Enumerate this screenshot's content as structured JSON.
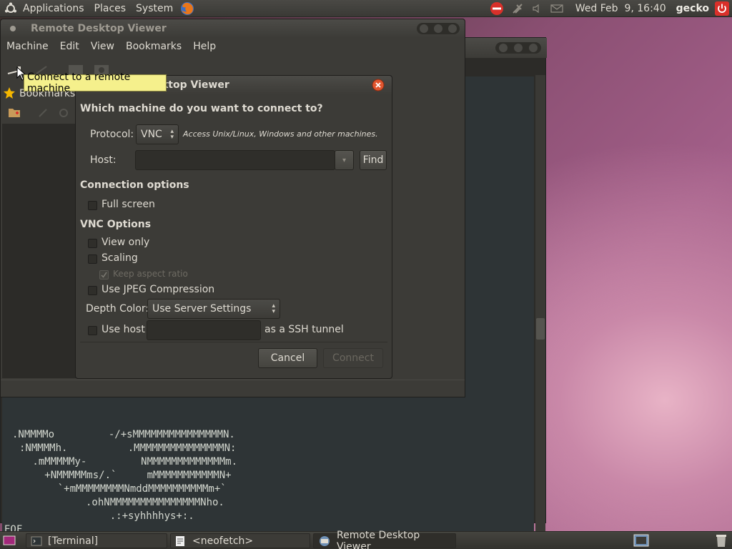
{
  "top_panel": {
    "menus": [
      "Applications",
      "Places",
      "System"
    ],
    "clock": "Wed Feb  9, 16:40",
    "user": "gecko"
  },
  "terminal": {
    "ascii_lines": [
      ".NMMMMo         -/+sMMMMMMMMMMMMMMMN.",
      ":NMMMMh.          .MMMMMMMMMMMMMMMN:",
      " .mMMMMMy-         NMMMMMMMMMMMMMm.",
      "   +NMMMMMms/.`     mMMMMMMMMMMMN+",
      "    `+mMMMMMMMMNmddMMMMMMMMMMm+`",
      "       .ohNMMMMMMMMMMMMMMMNho.",
      "           .:+syhhhhys+:."
    ],
    "eof": "EOF"
  },
  "viewer": {
    "title": "Remote Desktop Viewer",
    "menu": [
      "Machine",
      "Edit",
      "View",
      "Bookmarks",
      "Help"
    ],
    "sidebar_title": "Bookmarks"
  },
  "tooltip": "Connect to a remote machine",
  "dialog": {
    "title_visible": "ktop Viewer",
    "question": "Which machine do you want to connect to?",
    "protocol_label": "Protocol:",
    "protocol_value": "VNC",
    "protocol_hint": "Access Unix/Linux, Windows and other machines.",
    "host_label": "Host:",
    "host_value": "",
    "find_label": "Find",
    "connection_options_heading": "Connection options",
    "full_screen": "Full screen",
    "vnc_options_heading": "VNC Options",
    "view_only": "View only",
    "scaling": "Scaling",
    "keep_aspect": "Keep aspect ratio",
    "jpeg": "Use JPEG Compression",
    "depth_label": "Depth Color:",
    "depth_value": "Use Server Settings",
    "use_host": "Use host",
    "ssh_host_value": "",
    "ssh_suffix": "as a SSH tunnel",
    "cancel": "Cancel",
    "connect": "Connect"
  },
  "taskbar": {
    "items": [
      "[Terminal]",
      "<neofetch>",
      "Remote Desktop Viewer"
    ]
  },
  "colors": {
    "panel": "#3c3b37",
    "tooltip_bg": "#f5f08c",
    "close_button": "#e0552f"
  }
}
